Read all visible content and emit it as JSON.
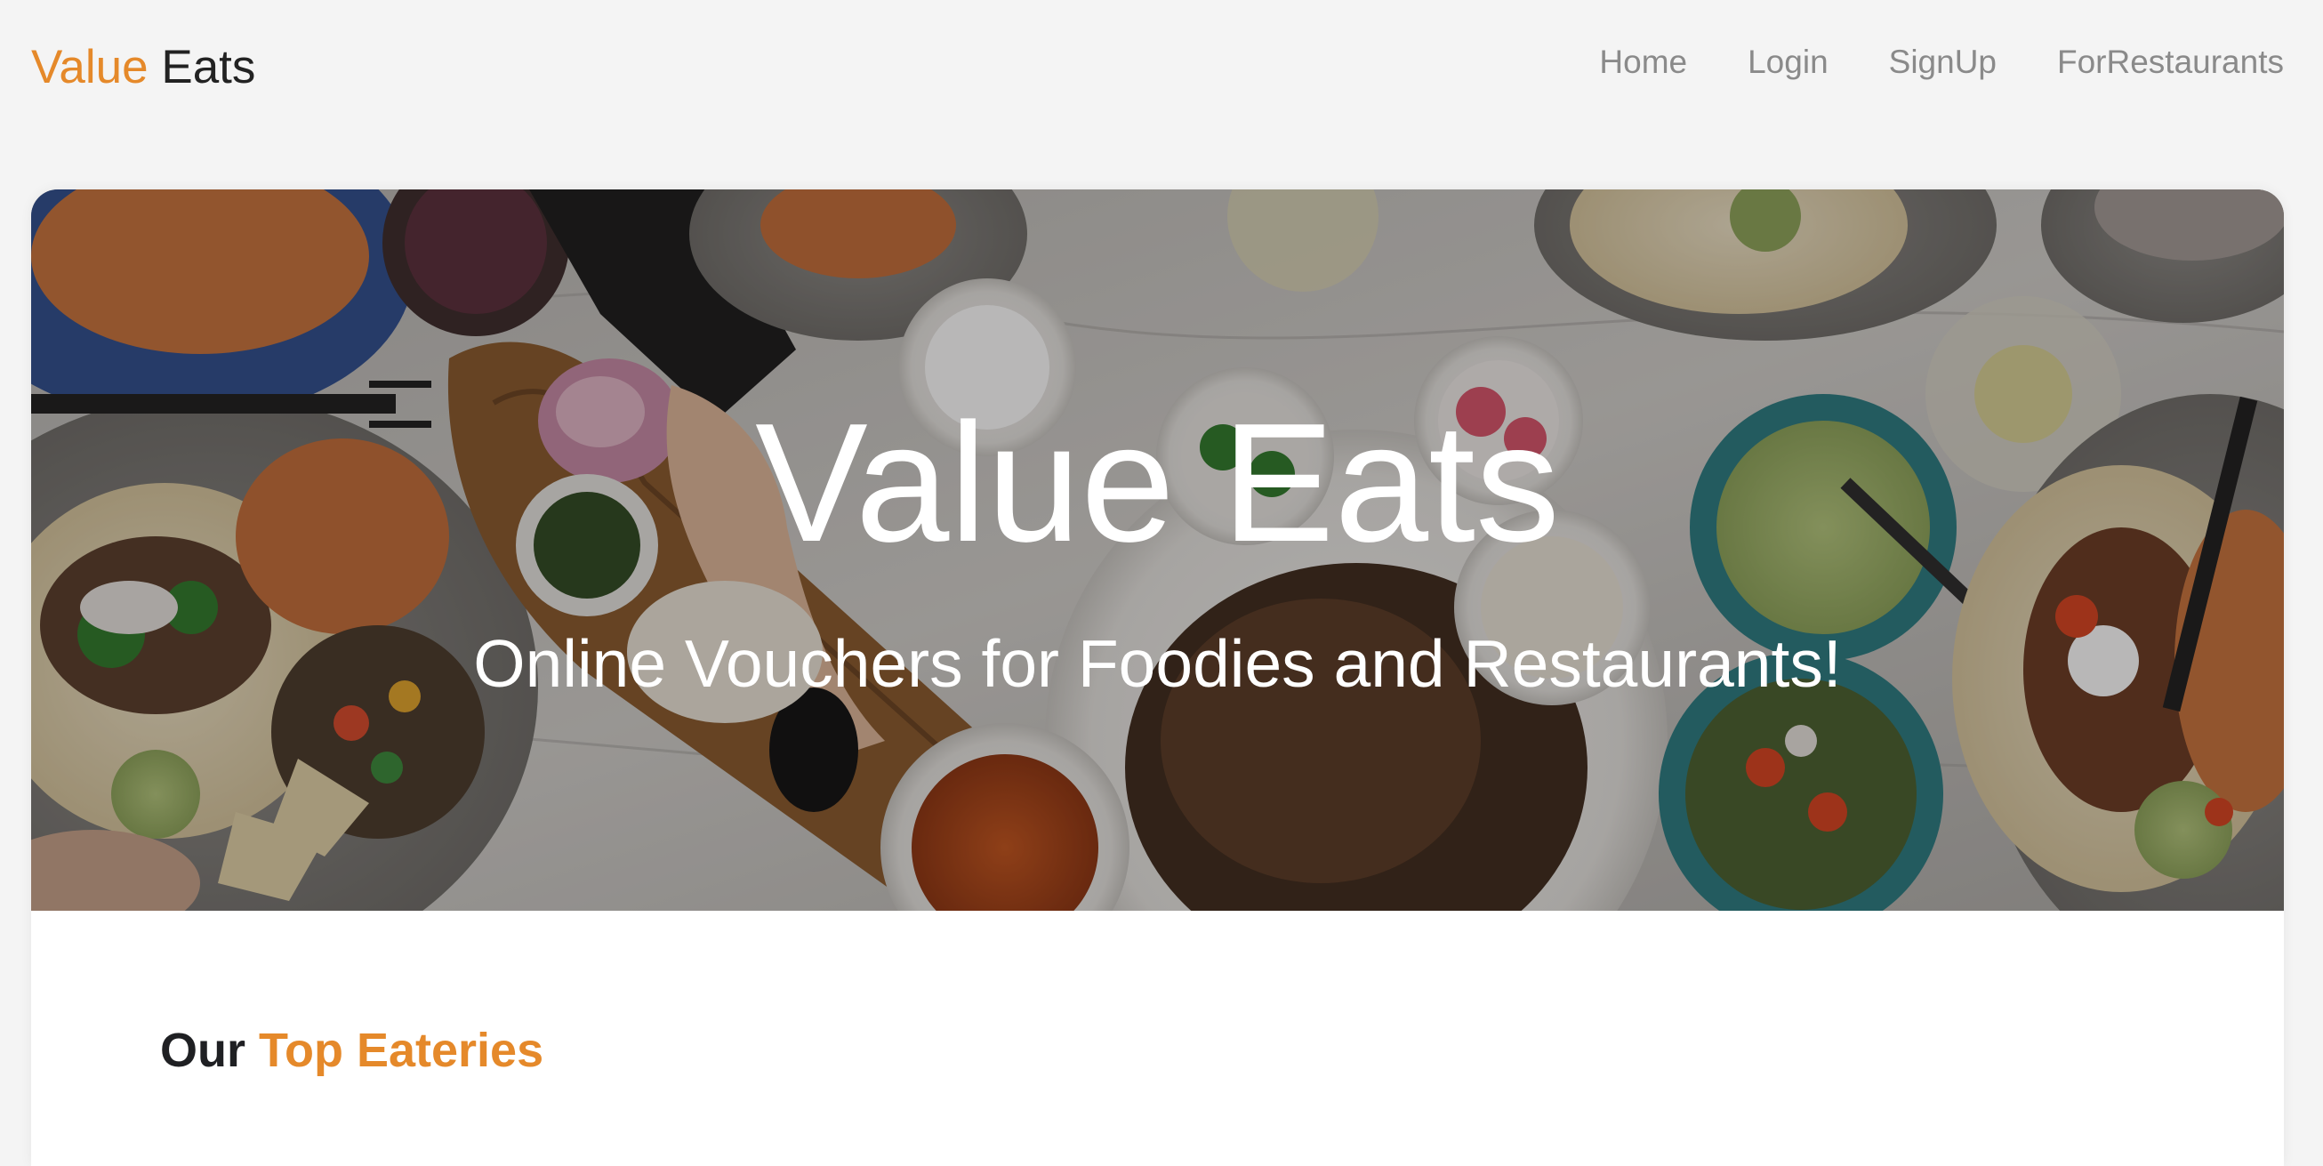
{
  "brand": {
    "part1": "Value",
    "part2": " Eats"
  },
  "nav": {
    "items": [
      {
        "label": "Home"
      },
      {
        "label": "Login"
      },
      {
        "label": "SignUp"
      },
      {
        "label": "ForRestaurants"
      }
    ]
  },
  "hero": {
    "title": "Value Eats",
    "subtitle": "Online Vouchers for Foodies and Restaurants!"
  },
  "section": {
    "heading_part1": "Our ",
    "heading_part2": "Top Eateries"
  },
  "colors": {
    "accent": "#e5892a",
    "nav_text": "#8a8a8a",
    "page_background": "#f4f4f4",
    "card_background": "#ffffff"
  }
}
